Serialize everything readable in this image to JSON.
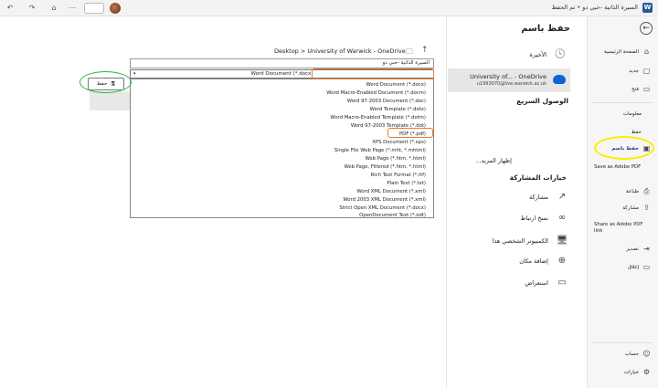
{
  "titlebar": {
    "doc_title": "السيرة الذاتية -حبي دو • تم الحفظ",
    "app_logo": "W",
    "controls": [
      "↶",
      "↷",
      "⌂",
      "⋯"
    ]
  },
  "nav": {
    "back_glyph": "←",
    "items": [
      {
        "label": "الصفحة الرئيسية",
        "icon": "home-icon",
        "glyph": "⌂"
      },
      {
        "label": "جديد",
        "icon": "new-doc-icon",
        "glyph": "▢"
      },
      {
        "label": "فتح",
        "icon": "open-folder-icon",
        "glyph": "▭"
      },
      {
        "label": "معلومات",
        "glyph": ""
      },
      {
        "label": "حفظ",
        "glyph": ""
      },
      {
        "label": "حفظ باسم",
        "icon": "save-as-icon",
        "glyph": "▣"
      },
      {
        "label": "Save as Adobe PDF",
        "glyph": ""
      },
      {
        "label": "طباعة",
        "icon": "print-icon",
        "glyph": "⎙"
      },
      {
        "label": "مشاركة",
        "icon": "share-icon",
        "glyph": "⇪"
      },
      {
        "label": "Share as Adobe PDF link",
        "glyph": ""
      },
      {
        "label": "تصدير",
        "icon": "export-icon",
        "glyph": "⇥"
      },
      {
        "label": "إغلاق",
        "icon": "close-doc-icon",
        "glyph": "▭"
      },
      {
        "label": "حساب",
        "icon": "account-icon",
        "glyph": "☺"
      },
      {
        "label": "خيارات",
        "icon": "options-icon",
        "glyph": "⚙"
      }
    ]
  },
  "middle": {
    "title": "حفظ باسم",
    "recent": "الأخيرة",
    "onedrive_name": "University of... - OneDrive",
    "onedrive_email": "u1993070@live.warwick.ac.uk",
    "quick_access": "الوصول السريع",
    "show_more": "إظهار المزيد...",
    "sharing_options": "خيارات المشاركة",
    "share_label": "مشاركة",
    "copy_link_label": "نسخ ارتباط",
    "this_pc": "الكمبيوتر الشخصي هذا",
    "add_place": "إضافة مكان",
    "browse": "استعراض"
  },
  "file": {
    "path": "Desktop > University of Warwick - OneDrive",
    "filename": "السيرة الذاتية -حبي دو",
    "selected_type": "Word Document (*.docx)",
    "types": [
      "Word Document (*.docx)",
      "Word Macro-Enabled Document (*.docm)",
      "Word 97-2003 Document (*.doc)",
      "Word Template (*.dotx)",
      "Word Macro-Enabled Template (*.dotm)",
      "Word 97-2003 Template (*.dot)",
      "PDF (*.pdf)",
      "XPS Document (*.xps)",
      "Single File Web Page (*.mht, *.mhtml)",
      "Web Page (*.htm, *.html)",
      "Web Page, Filtered (*.htm, *.html)",
      "Rich Text Format (*.rtf)",
      "Plain Text (*.txt)",
      "Word XML Document (*.xml)",
      "Word 2003 XML Document (*.xml)",
      "Strict Open XML Document (*.docx)",
      "OpenDocument Text (*.odt)"
    ],
    "save_button": "حفظ"
  },
  "highlight_colors": {
    "green": "#2db642",
    "orange": "#f07a2a",
    "yellow": "#ffeb00"
  }
}
